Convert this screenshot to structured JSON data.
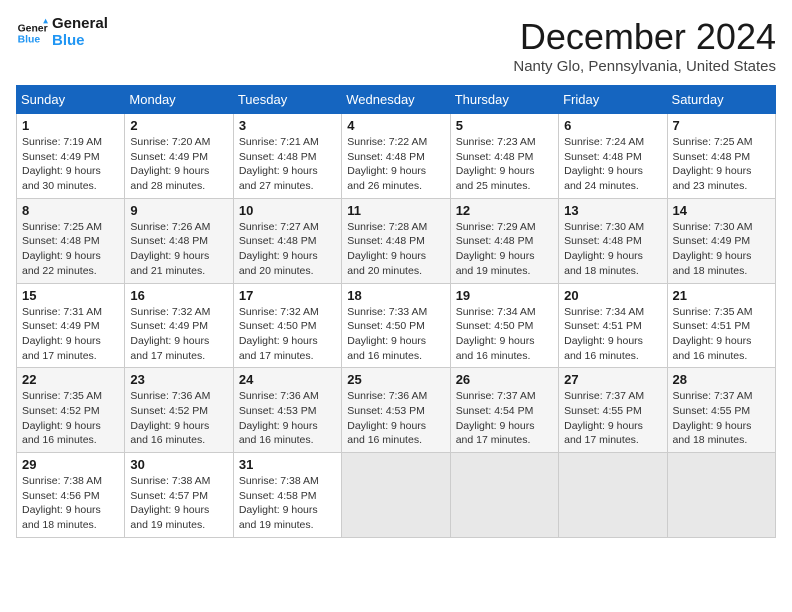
{
  "logo": {
    "line1": "General",
    "line2": "Blue"
  },
  "title": "December 2024",
  "location": "Nanty Glo, Pennsylvania, United States",
  "weekdays": [
    "Sunday",
    "Monday",
    "Tuesday",
    "Wednesday",
    "Thursday",
    "Friday",
    "Saturday"
  ],
  "weeks": [
    [
      {
        "day": "1",
        "sunrise": "7:19 AM",
        "sunset": "4:49 PM",
        "daylight": "9 hours and 30 minutes."
      },
      {
        "day": "2",
        "sunrise": "7:20 AM",
        "sunset": "4:49 PM",
        "daylight": "9 hours and 28 minutes."
      },
      {
        "day": "3",
        "sunrise": "7:21 AM",
        "sunset": "4:48 PM",
        "daylight": "9 hours and 27 minutes."
      },
      {
        "day": "4",
        "sunrise": "7:22 AM",
        "sunset": "4:48 PM",
        "daylight": "9 hours and 26 minutes."
      },
      {
        "day": "5",
        "sunrise": "7:23 AM",
        "sunset": "4:48 PM",
        "daylight": "9 hours and 25 minutes."
      },
      {
        "day": "6",
        "sunrise": "7:24 AM",
        "sunset": "4:48 PM",
        "daylight": "9 hours and 24 minutes."
      },
      {
        "day": "7",
        "sunrise": "7:25 AM",
        "sunset": "4:48 PM",
        "daylight": "9 hours and 23 minutes."
      }
    ],
    [
      {
        "day": "8",
        "sunrise": "7:25 AM",
        "sunset": "4:48 PM",
        "daylight": "9 hours and 22 minutes."
      },
      {
        "day": "9",
        "sunrise": "7:26 AM",
        "sunset": "4:48 PM",
        "daylight": "9 hours and 21 minutes."
      },
      {
        "day": "10",
        "sunrise": "7:27 AM",
        "sunset": "4:48 PM",
        "daylight": "9 hours and 20 minutes."
      },
      {
        "day": "11",
        "sunrise": "7:28 AM",
        "sunset": "4:48 PM",
        "daylight": "9 hours and 20 minutes."
      },
      {
        "day": "12",
        "sunrise": "7:29 AM",
        "sunset": "4:48 PM",
        "daylight": "9 hours and 19 minutes."
      },
      {
        "day": "13",
        "sunrise": "7:30 AM",
        "sunset": "4:48 PM",
        "daylight": "9 hours and 18 minutes."
      },
      {
        "day": "14",
        "sunrise": "7:30 AM",
        "sunset": "4:49 PM",
        "daylight": "9 hours and 18 minutes."
      }
    ],
    [
      {
        "day": "15",
        "sunrise": "7:31 AM",
        "sunset": "4:49 PM",
        "daylight": "9 hours and 17 minutes."
      },
      {
        "day": "16",
        "sunrise": "7:32 AM",
        "sunset": "4:49 PM",
        "daylight": "9 hours and 17 minutes."
      },
      {
        "day": "17",
        "sunrise": "7:32 AM",
        "sunset": "4:50 PM",
        "daylight": "9 hours and 17 minutes."
      },
      {
        "day": "18",
        "sunrise": "7:33 AM",
        "sunset": "4:50 PM",
        "daylight": "9 hours and 16 minutes."
      },
      {
        "day": "19",
        "sunrise": "7:34 AM",
        "sunset": "4:50 PM",
        "daylight": "9 hours and 16 minutes."
      },
      {
        "day": "20",
        "sunrise": "7:34 AM",
        "sunset": "4:51 PM",
        "daylight": "9 hours and 16 minutes."
      },
      {
        "day": "21",
        "sunrise": "7:35 AM",
        "sunset": "4:51 PM",
        "daylight": "9 hours and 16 minutes."
      }
    ],
    [
      {
        "day": "22",
        "sunrise": "7:35 AM",
        "sunset": "4:52 PM",
        "daylight": "9 hours and 16 minutes."
      },
      {
        "day": "23",
        "sunrise": "7:36 AM",
        "sunset": "4:52 PM",
        "daylight": "9 hours and 16 minutes."
      },
      {
        "day": "24",
        "sunrise": "7:36 AM",
        "sunset": "4:53 PM",
        "daylight": "9 hours and 16 minutes."
      },
      {
        "day": "25",
        "sunrise": "7:36 AM",
        "sunset": "4:53 PM",
        "daylight": "9 hours and 16 minutes."
      },
      {
        "day": "26",
        "sunrise": "7:37 AM",
        "sunset": "4:54 PM",
        "daylight": "9 hours and 17 minutes."
      },
      {
        "day": "27",
        "sunrise": "7:37 AM",
        "sunset": "4:55 PM",
        "daylight": "9 hours and 17 minutes."
      },
      {
        "day": "28",
        "sunrise": "7:37 AM",
        "sunset": "4:55 PM",
        "daylight": "9 hours and 18 minutes."
      }
    ],
    [
      {
        "day": "29",
        "sunrise": "7:38 AM",
        "sunset": "4:56 PM",
        "daylight": "9 hours and 18 minutes."
      },
      {
        "day": "30",
        "sunrise": "7:38 AM",
        "sunset": "4:57 PM",
        "daylight": "9 hours and 19 minutes."
      },
      {
        "day": "31",
        "sunrise": "7:38 AM",
        "sunset": "4:58 PM",
        "daylight": "9 hours and 19 minutes."
      },
      null,
      null,
      null,
      null
    ]
  ]
}
